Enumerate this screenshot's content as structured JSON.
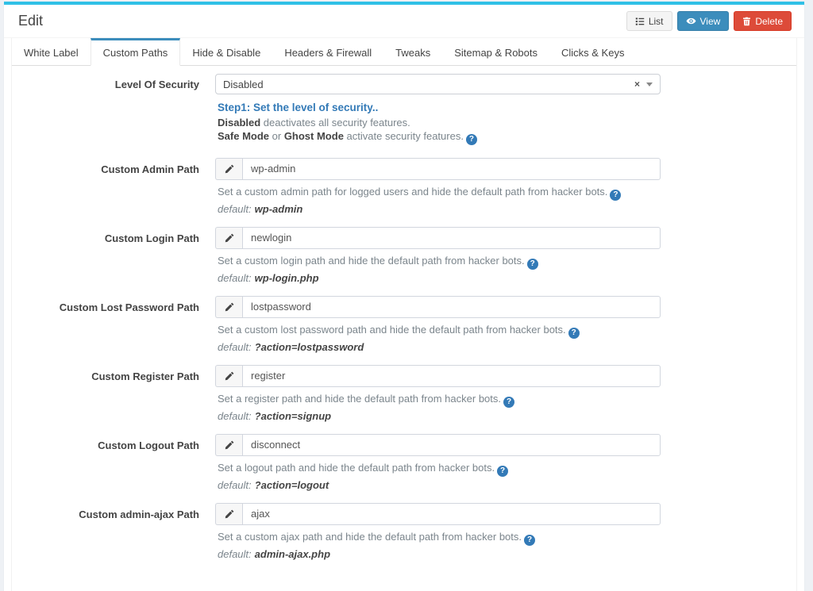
{
  "colors": {
    "top_bar": "#30c0e6",
    "primary": "#3c8dbc",
    "danger": "#dd4b39",
    "help_link_blue": "#337ab7"
  },
  "icons": {
    "list": "list-icon",
    "eye": "eye-icon",
    "trash": "trash-icon",
    "pencil": "pencil-icon",
    "question_circle": "question-circle-icon",
    "question_glyph": "?",
    "clear_glyph": "×"
  },
  "header": {
    "title": "Edit",
    "list_button": "List",
    "view_button": "View",
    "delete_button": "Delete"
  },
  "tabs": [
    "White Label",
    "Custom Paths",
    "Hide & Disable",
    "Headers & Firewall",
    "Tweaks",
    "Sitemap & Robots",
    "Clicks & Keys"
  ],
  "active_tab": "Custom Paths",
  "security": {
    "label": "Level Of Security",
    "value": "Disabled",
    "step_title": "Step1: Set the level of security..",
    "line1_bold": "Disabled",
    "line1_rest": " deactivates all security features.",
    "line2_bold1": "Safe Mode",
    "line2_mid": " or ",
    "line2_bold2": "Ghost Mode",
    "line2_rest": " activate security features."
  },
  "form": {
    "fields": [
      {
        "label": "Custom Admin Path",
        "value": "wp-admin",
        "help": "Set a custom admin path for logged users and hide the default path from hacker bots.",
        "default_label": "default:",
        "default_value": "wp-admin"
      },
      {
        "label": "Custom Login Path",
        "value": "newlogin",
        "help": "Set a custom login path and hide the default path from hacker bots.",
        "default_label": "default:",
        "default_value": "wp-login.php"
      },
      {
        "label": "Custom Lost Password Path",
        "value": "lostpassword",
        "help": "Set a custom lost password path and hide the default path from hacker bots.",
        "default_label": "default:",
        "default_value": "?action=lostpassword"
      },
      {
        "label": "Custom Register Path",
        "value": "register",
        "help": "Set a register path and hide the default path from hacker bots.",
        "default_label": "default:",
        "default_value": "?action=signup"
      },
      {
        "label": "Custom Logout Path",
        "value": "disconnect",
        "help": "Set a logout path and hide the default path from hacker bots.",
        "default_label": "default:",
        "default_value": "?action=logout"
      },
      {
        "label": "Custom admin-ajax Path",
        "value": "ajax",
        "help": "Set a custom ajax path and hide the default path from hacker bots.",
        "default_label": "default:",
        "default_value": "admin-ajax.php"
      }
    ]
  }
}
